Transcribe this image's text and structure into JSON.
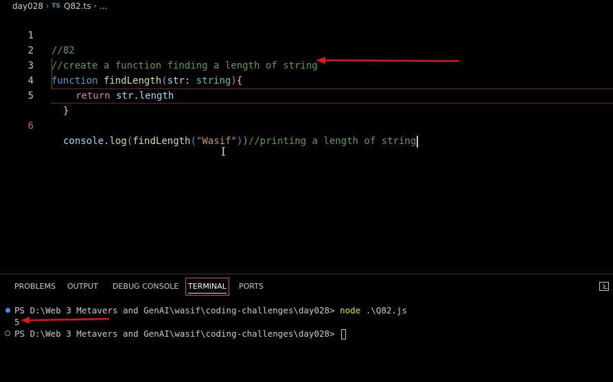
{
  "breadcrumb": {
    "folder": "day028",
    "file_badge": "TS",
    "file": "Q82.ts",
    "more": "..."
  },
  "editor": {
    "lines": [
      {
        "number": "1",
        "comment": "//82"
      },
      {
        "number": "2",
        "comment": "//create a function finding a length of string"
      },
      {
        "number": "3",
        "kw": "function",
        "fn": "findLength",
        "paren_open": "(",
        "param": "str",
        "colon": ": ",
        "type": "string",
        "paren_close": ")",
        "brace": "{"
      },
      {
        "number": "4",
        "kw": "return",
        "obj": "str",
        "dot": ".",
        "prop": "length"
      },
      {
        "number": "5",
        "brace": "}"
      },
      {
        "number": "6",
        "obj": "console",
        "dot": ".",
        "method": "log",
        "p1": "(",
        "fn": "findLength",
        "p2": "(",
        "str": "\"Wasif\"",
        "p2c": ")",
        "p1c": ")",
        "comment": "//printing a length of string"
      }
    ]
  },
  "panel": {
    "tabs": [
      "PROBLEMS",
      "OUTPUT",
      "DEBUG CONSOLE",
      "TERMINAL",
      "PORTS"
    ],
    "active_tab": "TERMINAL"
  },
  "terminal": {
    "prompt1": "PS D:\\Web 3 Metavers and GenAI\\wasif\\coding-challenges\\day028> ",
    "command_name": "node",
    "command_arg": " .\\Q82.js",
    "output": "5",
    "prompt2": "PS D:\\Web 3 Metavers and GenAI\\wasif\\coding-challenges\\day028> "
  },
  "colors": {
    "annotation_arrow": "#e0141e",
    "active_tab_outline": "#d04a3e",
    "active_line_number": "#cc6c2c"
  },
  "icons": [
    "chevron-right-icon",
    "typescript-file-icon",
    "terminal-maximize-icon",
    "text-cursor-icon",
    "annotation-arrow"
  ]
}
